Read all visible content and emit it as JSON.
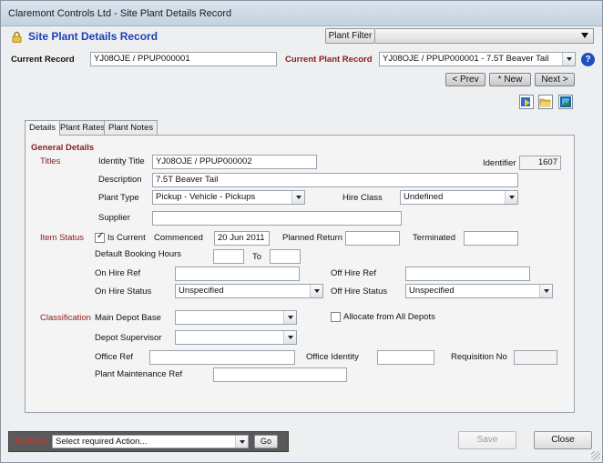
{
  "window": {
    "title": "Claremont Controls Ltd - Site Plant Details Record"
  },
  "header": {
    "form_title": "Site Plant Details Record",
    "plant_filter_label": "Plant Filter",
    "current_record_label": "Current Record",
    "current_record_value": "YJ08OJE / PPUP000001",
    "current_plant_record_label": "Current Plant Record",
    "current_plant_record_value": "YJ08OJE / PPUP000001 - 7.5T Beaver Tail",
    "help_glyph": "?"
  },
  "nav": {
    "prev_label": "< Prev",
    "new_label": "* New",
    "next_label": "Next >"
  },
  "toolbar_icons": [
    "import-icon",
    "open-folder-icon",
    "image-icon"
  ],
  "tabs": [
    {
      "label": "Details",
      "active": true
    },
    {
      "label": "Plant Rates",
      "active": false
    },
    {
      "label": "Plant Notes",
      "active": false
    }
  ],
  "details": {
    "general_details": "General Details",
    "titles_section": "Titles",
    "identity_title_label": "Identity Title",
    "identity_title_value": "YJ08OJE / PPUP000002",
    "identifier_label": "Identifier",
    "identifier_value": "1607",
    "description_label": "Description",
    "description_value": "7.5T Beaver Tail",
    "plant_type_label": "Plant Type",
    "plant_type_value": "Pickup - Vehicle - Pickups",
    "hire_class_label": "Hire Class",
    "hire_class_value": "Undefined",
    "supplier_label": "Supplier",
    "supplier_value": "",
    "item_status_section": "Item Status",
    "is_current_label": "Is Current",
    "is_current_checked": true,
    "commenced_label": "Commenced",
    "commenced_value": "20 Jun 2011",
    "planned_return_label": "Planned Return",
    "planned_return_value": "",
    "terminated_label": "Terminated",
    "terminated_value": "",
    "default_booking_hours_label": "Default Booking Hours",
    "booking_from_value": "",
    "to_label": "To",
    "booking_to_value": "",
    "on_hire_ref_label": "On Hire Ref",
    "on_hire_ref_value": "",
    "off_hire_ref_label": "Off Hire Ref",
    "off_hire_ref_value": "",
    "on_hire_status_label": "On Hire Status",
    "on_hire_status_value": "Unspecified",
    "off_hire_status_label": "Off Hire Status",
    "off_hire_status_value": "Unspecified",
    "classification_section": "Classification",
    "main_depot_base_label": "Main Depot Base",
    "main_depot_base_value": "",
    "allocate_all_depots_label": "Allocate from All Depots",
    "allocate_all_depots_checked": false,
    "depot_supervisor_label": "Depot Supervisor",
    "depot_supervisor_value": "",
    "office_ref_label": "Office Ref",
    "office_ref_value": "",
    "office_identity_label": "Office Identity",
    "office_identity_value": "",
    "requisition_no_label": "Requisition No",
    "requisition_no_value": "",
    "plant_maintenance_ref_label": "Plant Maintenance Ref",
    "plant_maintenance_ref_value": ""
  },
  "footer": {
    "actions_label": "Actions",
    "actions_placeholder": "Select required Action...",
    "go_label": "Go",
    "save_label": "Save",
    "close_label": "Close"
  },
  "colors": {
    "section_text": "#8b1a1a",
    "form_title_text": "#1f3fb8",
    "actions_bar": "#5a5a5a"
  }
}
